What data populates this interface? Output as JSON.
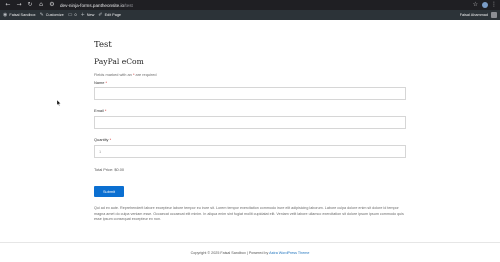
{
  "browser": {
    "url_host": "dev-ninja-forms.pantheonsite.io",
    "url_path": "/test"
  },
  "admin_bar": {
    "site_name": "Faisal Sandbox",
    "customize": "Customize",
    "comments_count": "0",
    "new": "New",
    "edit_page": "Edit Page",
    "user_greeting": "Faisal Ahammad"
  },
  "page": {
    "title": "Test",
    "form_title": "PayPal eCom",
    "required_note_prefix": "Fields marked with an",
    "required_note_star": "*",
    "required_note_suffix": "are required",
    "fields": [
      {
        "label": "Name",
        "star": "*",
        "value": ""
      },
      {
        "label": "Email",
        "star": "*",
        "value": ""
      },
      {
        "label": "Quantity",
        "star": "*",
        "value": "1"
      }
    ],
    "total_price": "Total Price: $0.00",
    "submit_label": "Submit",
    "body_text": "Qui ad ex aute. Reprehenderit labore excepteur labore tempor eu irure sit. Lorem tempor exercitation commodo irure elit adipisicing laborum. Labore culpa dolore enim sit dolore id tempor magna amet do culpa veniam esse. Occaecat occaecat elit minim. In aliqua enim sint fugiat mollit cupidatat elit. Veniam velit labore ullamco exercitation sit dolore ipsum ipsum commodo quis esse ipsum consequat excepteur ex non."
  },
  "footer": {
    "prefix": "Copyright © 2025 Faisal Sandbox | Powered by",
    "link": "Astra WordPress Theme"
  }
}
